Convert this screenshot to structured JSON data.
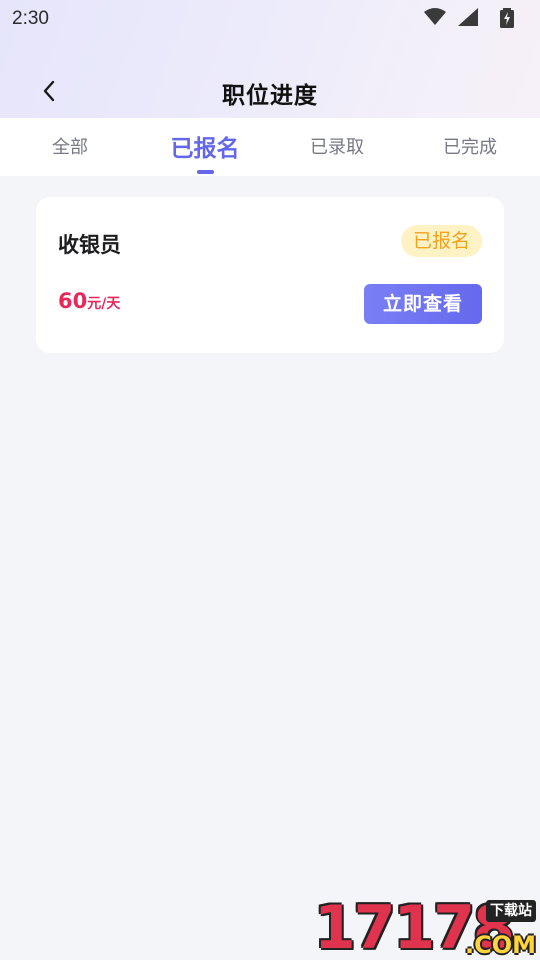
{
  "status_bar": {
    "time": "2:30"
  },
  "nav": {
    "title": "职位进度"
  },
  "tabs": [
    {
      "label": "全部",
      "active": false
    },
    {
      "label": "已报名",
      "active": true
    },
    {
      "label": "已录取",
      "active": false
    },
    {
      "label": "已完成",
      "active": false
    }
  ],
  "job_card": {
    "title": "收银员",
    "status": "已报名",
    "salary_amount": "60",
    "salary_unit": "元/天",
    "button_label": "立即查看"
  },
  "watermark": {
    "digits": "17178",
    "badge": "下载站",
    "suffix": ".COM"
  },
  "colors": {
    "accent": "#6468e8",
    "salary": "#e8275a",
    "badge_text": "#f2a21c",
    "badge_bg": "#fff3c6"
  },
  "icons": {
    "back": "chevron-left-icon",
    "wifi": "wifi-icon",
    "signal": "cell-signal-icon",
    "battery": "battery-charging-icon"
  }
}
